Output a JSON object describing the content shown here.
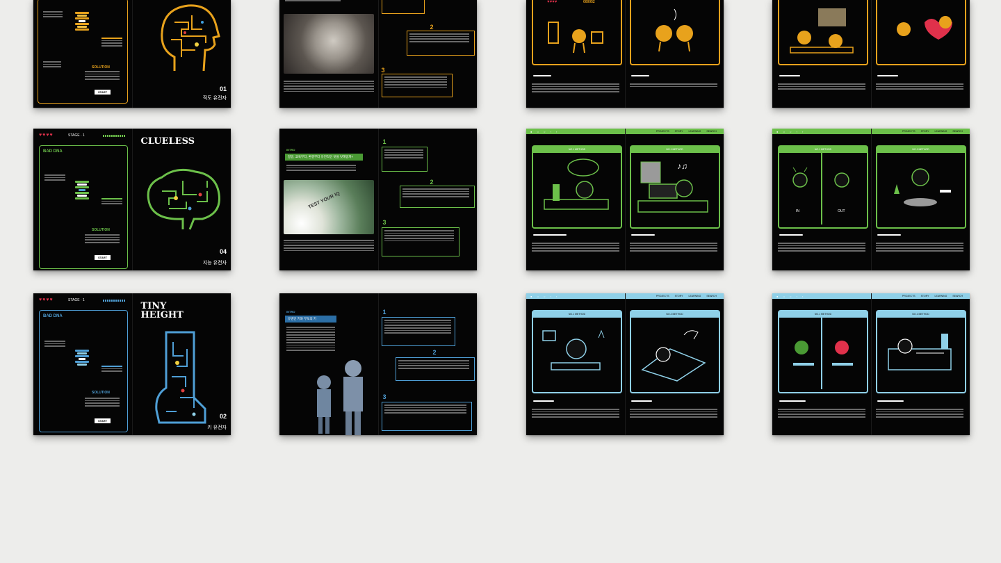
{
  "brochure": {
    "heart_icons": "♥♥♥♥",
    "stage_label": "STAGE · 1",
    "solution": "SOLUTION",
    "start": "START",
    "bad_dna": "BAD DNA",
    "intro": "INTRO",
    "nav_items": [
      "PROJECTS",
      "STORY",
      "LEARNING",
      "SEARCH"
    ],
    "score": "000052"
  },
  "spreads": {
    "gene1": {
      "number": "01",
      "name": "적도 유전자"
    },
    "gene4": {
      "number": "04",
      "name": "지능 유전자",
      "title": "CLUELESS"
    },
    "gene2": {
      "number": "02",
      "name": "키 유전자",
      "title_line1": "TINY",
      "title_line2": "HEIGHT"
    },
    "intro_iq": {
      "banner": "정말, 교육부터, 환경부터 유전적인 탓을 탓해일까?",
      "photo_text": "TEST YOUR IQ"
    },
    "intro_height": {
      "banner": "유명인 키와 부모의 키"
    },
    "panels": {
      "method": "NO.1 METHOD",
      "method2": "NO.2 METHOD",
      "in": "IN",
      "out": "OUT"
    }
  },
  "colors": {
    "yellow": "#e8a21c",
    "green": "#6cc04a",
    "blue": "#4f9fd6",
    "lightblue": "#8fd0e8"
  }
}
